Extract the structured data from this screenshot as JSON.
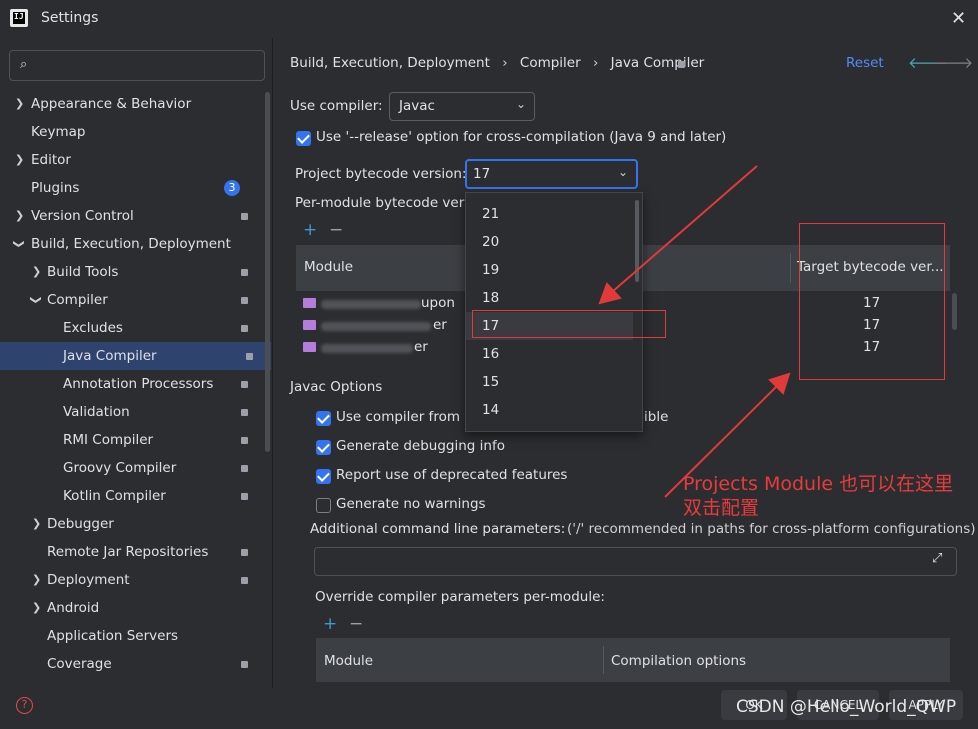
{
  "window": {
    "title": "Settings",
    "app_icon": "IJ"
  },
  "sidebar": {
    "search_placeholder": "",
    "items": [
      {
        "label": "Appearance & Behavior"
      },
      {
        "label": "Keymap"
      },
      {
        "label": "Editor"
      },
      {
        "label": "Plugins",
        "badge": "3"
      },
      {
        "label": "Version Control"
      },
      {
        "label": "Build, Execution, Deployment"
      },
      {
        "label": "Build Tools"
      },
      {
        "label": "Compiler"
      },
      {
        "label": "Excludes"
      },
      {
        "label": "Java Compiler"
      },
      {
        "label": "Annotation Processors"
      },
      {
        "label": "Validation"
      },
      {
        "label": "RMI Compiler"
      },
      {
        "label": "Groovy Compiler"
      },
      {
        "label": "Kotlin Compiler"
      },
      {
        "label": "Debugger"
      },
      {
        "label": "Remote Jar Repositories"
      },
      {
        "label": "Deployment"
      },
      {
        "label": "Android"
      },
      {
        "label": "Application Servers"
      },
      {
        "label": "Coverage"
      }
    ]
  },
  "header": {
    "crumbs": [
      "Build, Execution, Deployment",
      "Compiler",
      "Java Compiler"
    ],
    "separator": "›",
    "reset": "Reset",
    "back_icon": "arrow-left-icon",
    "forward_icon": "arrow-right-icon"
  },
  "compiler": {
    "use_compiler_label": "Use compiler:",
    "use_compiler_value": "Javac",
    "release_option_label": "Use '--release' option for cross-compilation (Java 9 and later)",
    "release_option_checked": true,
    "bytecode_label": "Project bytecode version:",
    "bytecode_value": "17",
    "per_module_label": "Per-module bytecode versi",
    "module_col": "Module",
    "target_col": "Target bytecode ver...",
    "module_rows": [
      {
        "name_tail": "upon",
        "target": "17"
      },
      {
        "name_tail": "er",
        "target": "17"
      },
      {
        "name_tail": "er",
        "target": "17"
      }
    ],
    "dropdown_options": [
      "21",
      "20",
      "19",
      "18",
      "17",
      "16",
      "15",
      "14"
    ],
    "dropdown_selected": "17"
  },
  "javac": {
    "section_label": "Javac Options",
    "options": [
      {
        "label": "Use compiler from m",
        "tail": "ible",
        "checked": true
      },
      {
        "label": "Generate debugging info",
        "checked": true
      },
      {
        "label": "Report use of deprecated features",
        "checked": true
      },
      {
        "label": "Generate no warnings",
        "checked": false
      }
    ],
    "params_label": "Additional command line parameters:",
    "params_hint": "('/' recommended in paths for cross-platform configurations)",
    "params_value": "",
    "override_label": "Override compiler parameters per-module:",
    "override_module_col": "Module",
    "override_options_col": "Compilation options"
  },
  "annotation": {
    "line1": "Projects Module 也可以在这里",
    "line2": "双击配置",
    "color": "#e83b3b"
  },
  "footer": {
    "ok": "OK",
    "cancel": "CANCEL",
    "apply": "APPLY",
    "help_icon": "help-icon"
  },
  "watermark": "CSDN @Hello_World_QWP",
  "colors": {
    "accent": "#3574f0",
    "selection": "#2e436e",
    "annotation": "#e83b3b"
  }
}
